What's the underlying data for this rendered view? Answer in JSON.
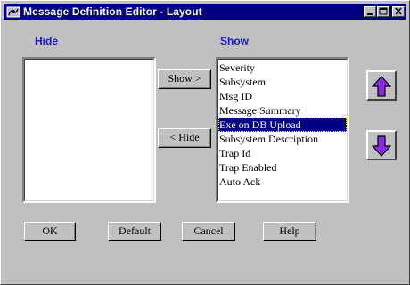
{
  "window": {
    "title": "Message Definition Editor - Layout",
    "controls": [
      "minimize-icon",
      "maximize-icon",
      "close-icon"
    ]
  },
  "hide_panel": {
    "caption": "Hide",
    "items": []
  },
  "show_panel": {
    "caption": "Show",
    "items": [
      "Severity",
      "Subsystem",
      "Msg ID",
      "Message Summary",
      "Exe on DB Upload",
      "Subsystem Description",
      "Trap Id",
      "Trap Enabled",
      "Auto Ack"
    ],
    "selected_index": 4
  },
  "transfer": {
    "show_label": "Show >",
    "hide_label": "< Hide"
  },
  "order": {
    "up_icon": "arrow-up-icon",
    "down_icon": "arrow-down-icon"
  },
  "footer": {
    "ok": "OK",
    "default": "Default",
    "cancel": "Cancel",
    "help": "Help"
  },
  "colors": {
    "titlebar": "#000080",
    "caption": "#1a1ad4",
    "arrow": "#8a2be2",
    "selection": "#000080"
  }
}
